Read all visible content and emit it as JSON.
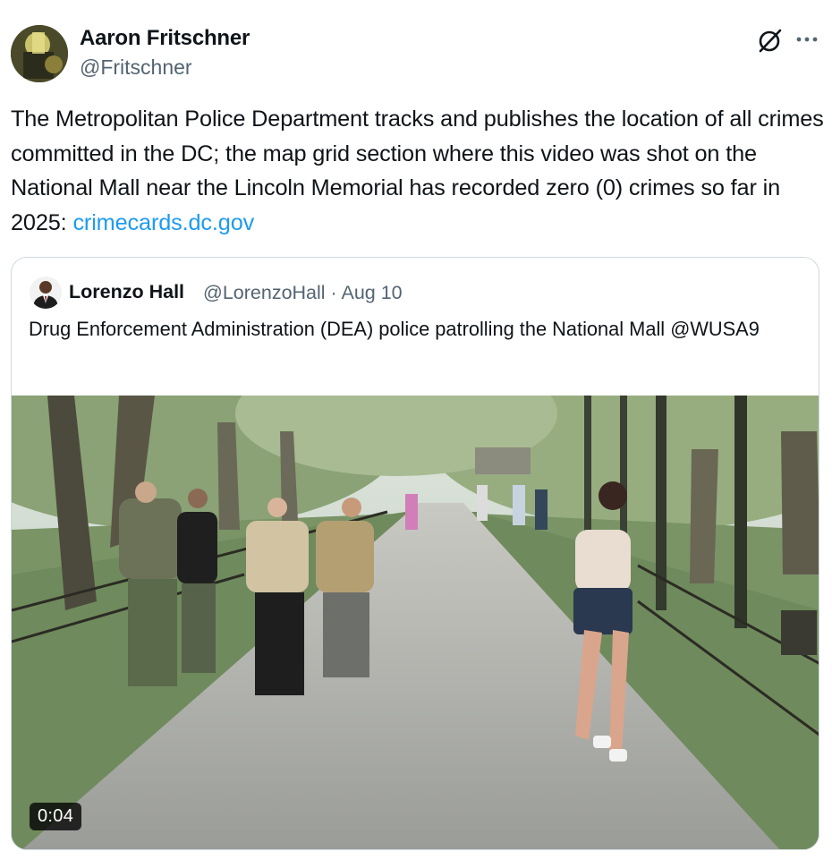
{
  "author": {
    "name": "Aaron Fritschner",
    "handle": "@Fritschner"
  },
  "post": {
    "text": "The Metropolitan Police Department tracks and publishes the location of all crimes committed in the DC; the map grid section where this video was shot on the National Mall near the Lincoln Memorial has recorded zero (0) crimes so far in 2025: ",
    "link_text": "crimecards.dc.gov"
  },
  "quoted_post": {
    "author_name": "Lorenzo Hall",
    "author_handle_and_date": "@LorenzoHall · Aug 10",
    "text": "Drug Enforcement Administration (DEA) police patrolling the National Mall @WUSA9",
    "video_duration": "0:04"
  },
  "icons": {
    "grok": "grok-icon",
    "more": "more-icon"
  },
  "colors": {
    "link": "#1d9bf0",
    "secondary_text": "#536471",
    "border": "#cfd9de"
  }
}
